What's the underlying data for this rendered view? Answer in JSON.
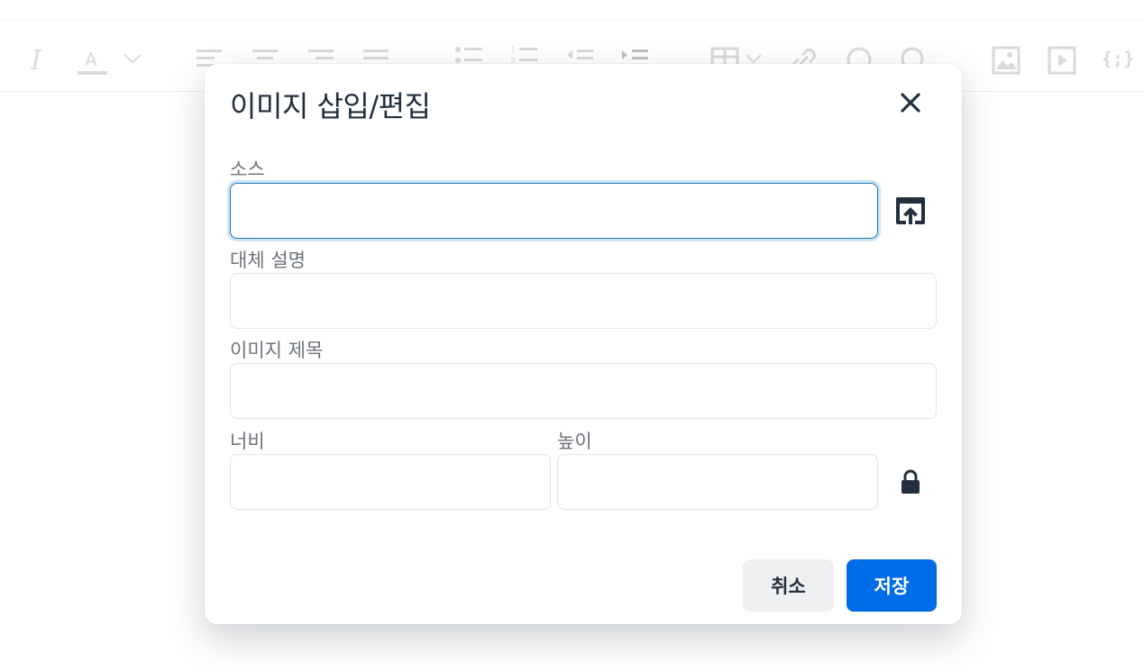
{
  "toolbar": {
    "icons": [
      "italic-icon",
      "text-color-icon",
      "chevron-down-icon",
      "align-left-icon",
      "align-center-icon",
      "align-right-icon",
      "align-justify-icon",
      "bullet-list-icon",
      "numbered-list-icon",
      "outdent-icon",
      "indent-icon",
      "table-icon",
      "link-icon",
      "comment-icon",
      "search-icon",
      "image-icon",
      "media-icon",
      "code-icon"
    ],
    "code_label": "{;}"
  },
  "dialog": {
    "title": "이미지 삽입/편집",
    "close_icon": "close-icon",
    "source": {
      "label": "소스",
      "value": "",
      "upload_icon": "upload-icon"
    },
    "alt": {
      "label": "대체 설명",
      "value": ""
    },
    "image_title": {
      "label": "이미지 제목",
      "value": ""
    },
    "width": {
      "label": "너비",
      "value": ""
    },
    "height": {
      "label": "높이",
      "value": ""
    },
    "lock_icon": "lock-icon",
    "cancel_label": "취소",
    "save_label": "저장"
  },
  "colors": {
    "primary": "#006ce7",
    "focus": "#207ab7",
    "text": "#222f3e",
    "label": "#6d737a",
    "toolbar_icon": "#c3c6ca"
  }
}
